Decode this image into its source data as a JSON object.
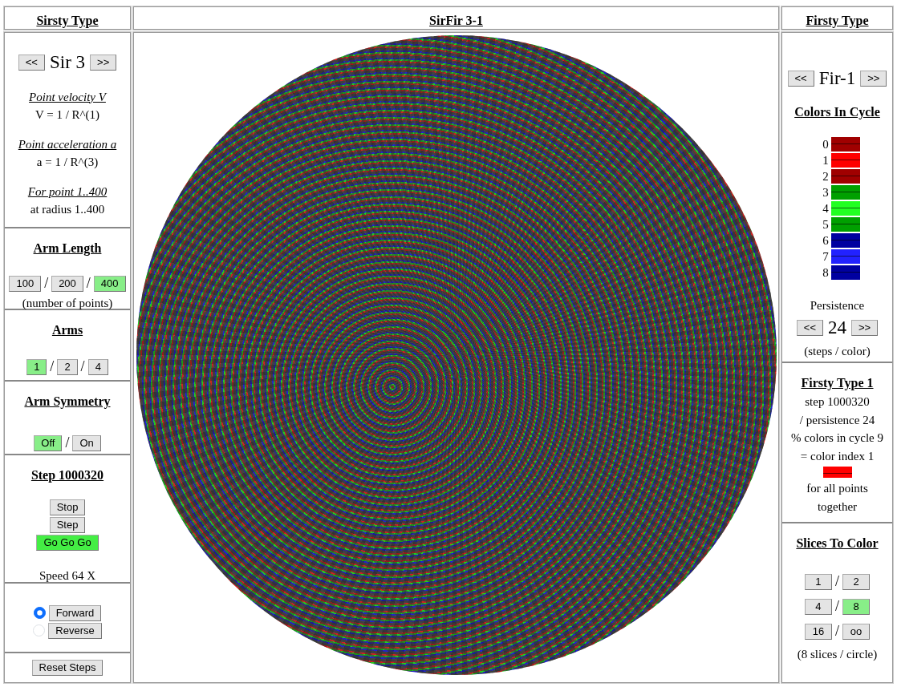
{
  "left_panel": {
    "title": "Sirsty Type",
    "type_selector": {
      "prev": "<<",
      "value": "Sir 3",
      "next": ">>"
    },
    "descriptions": [
      {
        "heading": "Point velocity V",
        "text": "V = 1 / R^(1)"
      },
      {
        "heading": "Point acceleration a",
        "text": "a = 1 / R^(3)"
      },
      {
        "heading": "For point 1..400",
        "text": "at radius 1..400"
      }
    ],
    "arm_length": {
      "title": "Arm Length",
      "options": [
        {
          "label": "100",
          "selected": false
        },
        {
          "label": "200",
          "selected": false
        },
        {
          "label": "400",
          "selected": true
        }
      ],
      "separators": [
        "/",
        "/"
      ],
      "note": "(number of points)"
    },
    "arms": {
      "title": "Arms",
      "options": [
        {
          "label": "1",
          "selected": true
        },
        {
          "label": "2",
          "selected": false
        },
        {
          "label": "4",
          "selected": false
        }
      ],
      "separators": [
        "/",
        "/"
      ]
    },
    "arm_symmetry": {
      "title": "Arm Symmetry",
      "options": [
        {
          "label": "Off",
          "selected": true
        },
        {
          "label": "On",
          "selected": false
        }
      ],
      "separators": [
        "/"
      ]
    },
    "step": {
      "title": "Step 1000320",
      "buttons": [
        {
          "label": "Stop",
          "selected": false
        },
        {
          "label": "Step",
          "selected": false
        },
        {
          "label": "Go Go Go",
          "selected": true
        }
      ],
      "speed": "Speed 64 X"
    },
    "direction": [
      {
        "label": "Forward",
        "selected": true
      },
      {
        "label": "Reverse",
        "selected": false
      }
    ],
    "reset": "Reset Steps"
  },
  "center_panel": {
    "title": "SirFir 3-1"
  },
  "right_panel": {
    "title": "Firsty Type",
    "type_selector": {
      "prev": "<<",
      "value": "Fir-1",
      "next": ">>"
    },
    "colors_title": "Colors In Cycle",
    "colors": [
      {
        "index": "0",
        "color": "#a00000"
      },
      {
        "index": "1",
        "color": "#ff0000"
      },
      {
        "index": "2",
        "color": "#a00000"
      },
      {
        "index": "3",
        "color": "#00a000"
      },
      {
        "index": "4",
        "color": "#22ff22"
      },
      {
        "index": "5",
        "color": "#00a000"
      },
      {
        "index": "6",
        "color": "#0000a0"
      },
      {
        "index": "7",
        "color": "#2222ff"
      },
      {
        "index": "8",
        "color": "#0000a0"
      }
    ],
    "persistence": {
      "label": "Persistence",
      "prev": "<<",
      "value": "24",
      "next": ">>",
      "note": "(steps / color)"
    },
    "result": {
      "title": "Firsty Type 1",
      "lines": [
        "step 1000320",
        "/ persistence 24",
        "% colors in cycle 9",
        "= color index 1"
      ],
      "color": "#ff0000",
      "footer": "for all points together"
    },
    "slices": {
      "title": "Slices To Color",
      "rows": [
        {
          "options": [
            {
              "label": "1",
              "selected": false
            },
            {
              "label": "2",
              "selected": false
            }
          ],
          "separator": "/"
        },
        {
          "options": [
            {
              "label": "4",
              "selected": false
            },
            {
              "label": "8",
              "selected": true
            }
          ],
          "separator": "/"
        },
        {
          "options": [
            {
              "label": "16",
              "selected": false
            },
            {
              "label": "oo",
              "selected": false
            }
          ],
          "separator": "/"
        }
      ],
      "note": "(8 slices / circle)"
    }
  }
}
